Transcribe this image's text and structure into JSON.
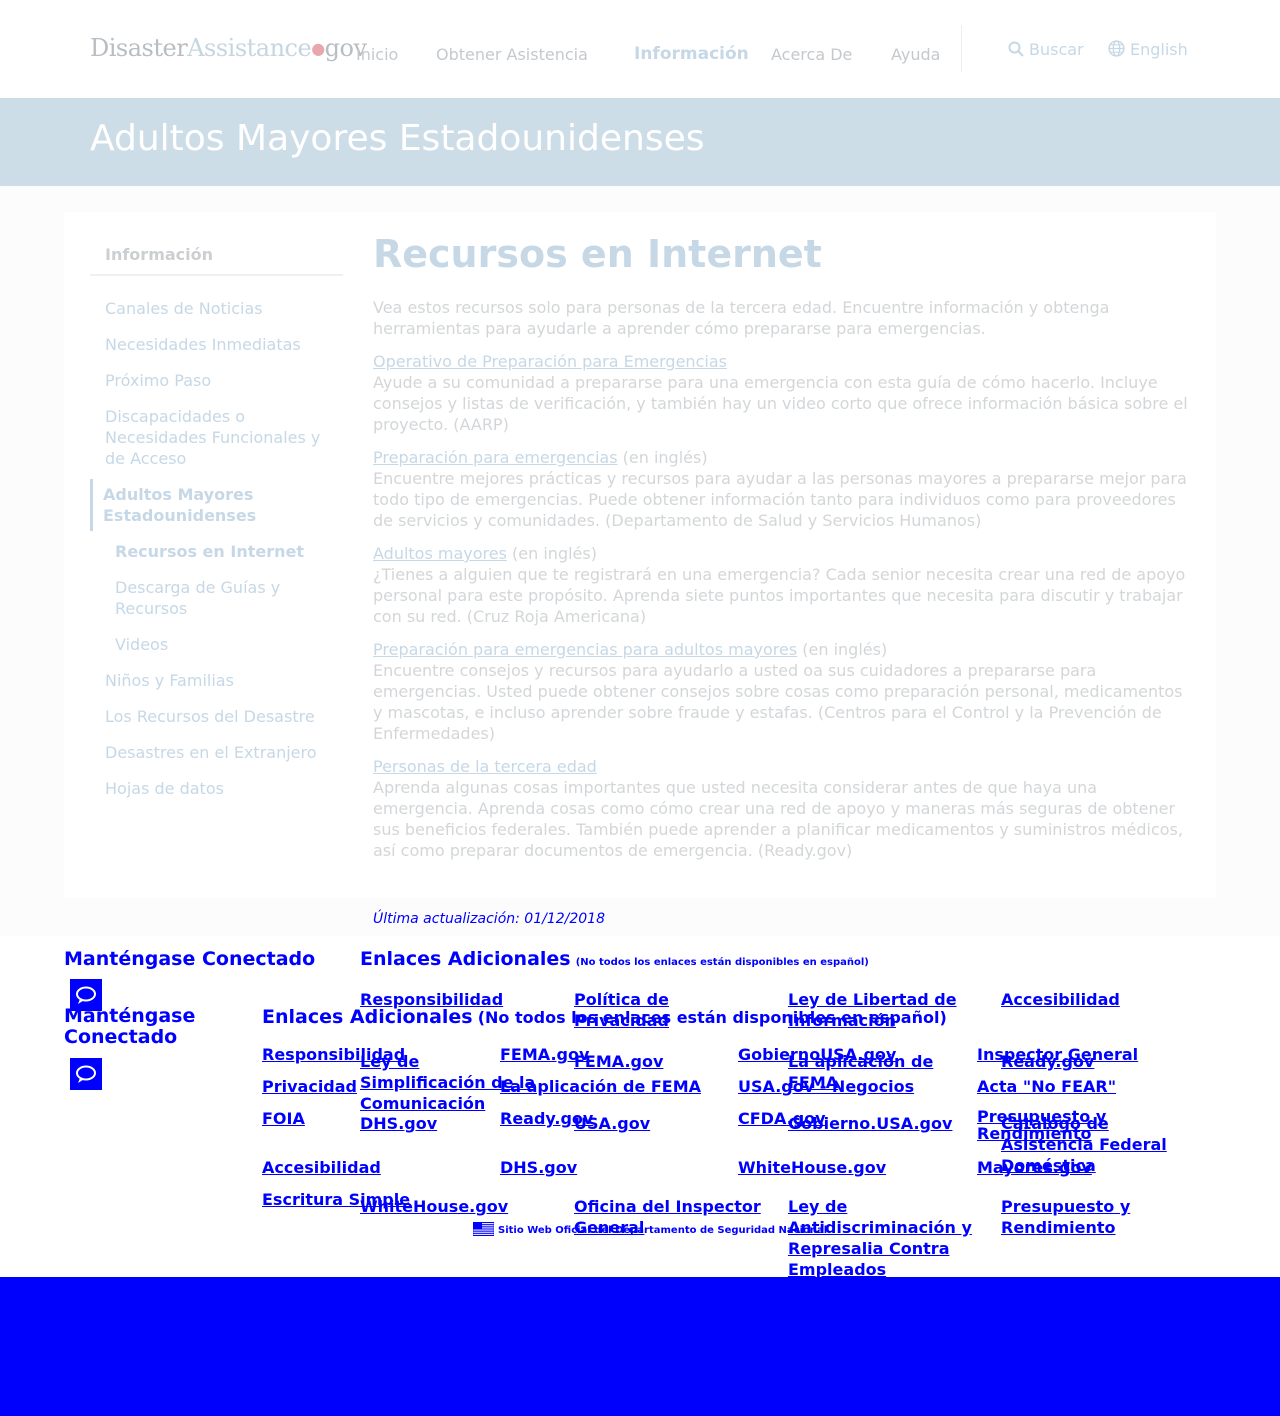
{
  "header": {
    "logo_part1": "Disaster",
    "logo_part2": "Assistance",
    "logo_dot": "●",
    "logo_part3": "gov",
    "nav": [
      "Inicio",
      "Obtener Asistencia",
      "Información",
      "Acerca De",
      "Ayuda"
    ],
    "active_nav": "Información",
    "search_label": "Buscar",
    "search_icon": "search-icon",
    "language_label": "English",
    "language_icon": "globe-icon"
  },
  "banner": {
    "title": "Adultos Mayores Estadounidenses"
  },
  "sidebar": {
    "heading": "Información",
    "items": [
      "Canales de Noticias",
      "Necesidades Inmediatas",
      "Próximo Paso",
      "Discapacidades o Necesidades Funcionales y de Acceso",
      "Adultos Mayores Estadounidenses",
      "Recursos en Internet",
      "Descarga de Guías y Recursos",
      "Videos",
      "Niños y Familias",
      "Los Recursos del Desastre",
      "Desastres en el Extranjero",
      "Hojas de datos"
    ]
  },
  "content": {
    "title": "Recursos en Internet",
    "intro": "Vea estos recursos solo para personas de la tercera edad. Encuentre información y obtenga herramientas para ayudarle a aprender cómo prepararse para emergencias.",
    "resources": [
      {
        "link": "Operativo de Preparación para Emergencias",
        "note": "",
        "desc": "Ayude a su comunidad a prepararse para una emergencia con esta guía de cómo hacerlo. Incluye consejos y listas de verificación, y también hay un video corto que ofrece información básica sobre el proyecto. (AARP)"
      },
      {
        "link": "Preparación para emergencias",
        "note": " (en inglés)",
        "desc": "Encuentre mejores prácticas y recursos para ayudar a las personas mayores a prepararse mejor para todo tipo de emergencias. Puede obtener información tanto para individuos como para proveedores de servicios y comunidades. (Departamento de Salud y Servicios Humanos)"
      },
      {
        "link": "Adultos mayores",
        "note": " (en inglés)",
        "desc": "¿Tienes a alguien que te registrará en una emergencia? Cada senior necesita crear una red de apoyo personal para este propósito. Aprenda siete puntos importantes que necesita para discutir y trabajar con su red. (Cruz Roja Americana)"
      },
      {
        "link": "Preparación para emergencias para adultos mayores",
        "note": " (en inglés)",
        "desc": "Encuentre consejos y recursos para ayudarlo a usted oa sus cuidadores a prepararse para emergencias. Usted puede obtener consejos sobre cosas como preparación personal, medicamentos y mascotas, e incluso aprender sobre fraude y estafas. (Centros para el Control y la Prevención de Enfermedades)"
      },
      {
        "link": "Personas de la tercera edad",
        "note": "",
        "desc": "Aprenda algunas cosas importantes que usted necesita considerar antes de que haya una emergencia. Aprenda cosas como cómo crear una red de apoyo y maneras más seguras de obtener sus beneficios federales. También puede aprender a planificar medicamentos y suministros médicos, así como preparar documentos de emergencia. (Ready.gov)"
      }
    ],
    "last_updated": "Última actualización: 01/12/2018"
  },
  "footer_a": {
    "connect_heading": "Manténgase Conectado",
    "links_heading": "Enlaces Adicionales",
    "links_note": "(No todos los enlaces están disponibles en español)",
    "links": [
      "Responsibilidad",
      "Política de Privacidad",
      "Ley de Libertad de Información",
      "Accesibilidad",
      "Ley de Simplificación de la Comunicación",
      "FEMA.gov",
      "La aplicación de FEMA",
      "Ready.gov",
      "DHS.gov",
      "USA.gov",
      "Gobierno.USA.gov",
      "Catálogo de Asistencia Federal Doméstica",
      "WhiteHouse.gov",
      "Oficina del Inspector General",
      "Ley de Antidiscriminación y Represalia Contra Empleados Federales",
      "Presupuesto y Rendimiento"
    ]
  },
  "footer_b": {
    "connect_heading": "Manténgase Conectado",
    "links_heading": "Enlaces Adicionales",
    "links_note": "(No todos los enlaces están disponibles en español)",
    "col1": [
      "Responsibilidad",
      "Privacidad",
      "FOIA",
      "Accesibilidad",
      "Escritura Simple"
    ],
    "col2": [
      "FEMA.gov",
      "La aplicación de FEMA",
      "Ready.gov",
      "DHS.gov"
    ],
    "col3": [
      "GobiernoUSA.gov",
      "USA.gov - Negocios",
      "CFDA.gov",
      "WhiteHouse.gov"
    ],
    "col4": [
      "Inspector General",
      "Acta \"No FEAR\"",
      "Presupuesto y Rendimiento",
      "Mayores.gov"
    ]
  },
  "official_notice": "Sitio Web Oficial del Departamento de Seguridad Nacional",
  "icons": {
    "chat": "chat-bubble-icon",
    "flag": "us-flag-icon"
  },
  "colors": {
    "link": "#0000ff",
    "banner": "#cddde7",
    "accent": "#c6d8e6",
    "bottom_bar": "#0000fd"
  }
}
